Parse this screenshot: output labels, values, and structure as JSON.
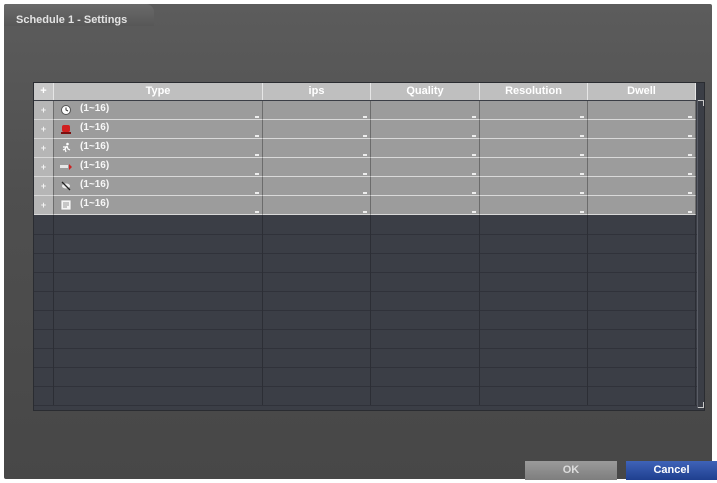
{
  "dialog": {
    "title": "Schedule 1 - Settings"
  },
  "table": {
    "columns": [
      "+",
      "Type",
      "ips",
      "Quality",
      "Resolution",
      "Dwell"
    ],
    "rows": [
      {
        "plus": "+",
        "icon": "alarm-clock-icon",
        "label": "(1~16)",
        "ips": "",
        "quality": "",
        "resolution": "",
        "dwell": ""
      },
      {
        "plus": "+",
        "icon": "red-siren-icon",
        "label": "(1~16)",
        "ips": "",
        "quality": "",
        "resolution": "",
        "dwell": ""
      },
      {
        "plus": "+",
        "icon": "running-person-icon",
        "label": "(1~16)",
        "ips": "",
        "quality": "",
        "resolution": "",
        "dwell": ""
      },
      {
        "plus": "+",
        "icon": "alarm-in-icon",
        "label": "(1~16)",
        "ips": "",
        "quality": "",
        "resolution": "",
        "dwell": ""
      },
      {
        "plus": "+",
        "icon": "video-loss-icon",
        "label": "(1~16)",
        "ips": "",
        "quality": "",
        "resolution": "",
        "dwell": ""
      },
      {
        "plus": "+",
        "icon": "text-input-icon",
        "label": "(1~16)",
        "ips": "",
        "quality": "",
        "resolution": "",
        "dwell": ""
      }
    ]
  },
  "buttons": {
    "ok": "OK",
    "cancel": "Cancel"
  },
  "colors": {
    "accent": "#1f3f8f",
    "header": "#bfbfbf",
    "row": "#9c9c9c",
    "background": "#4f4f4f"
  }
}
